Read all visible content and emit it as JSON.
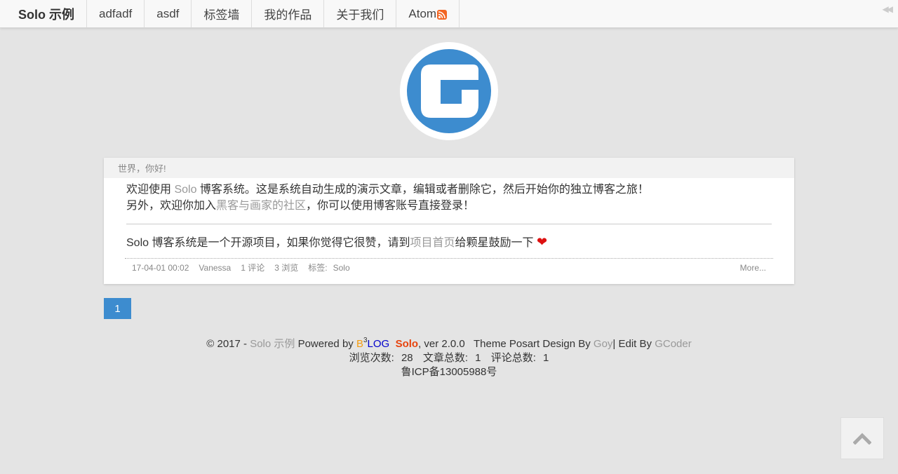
{
  "nav": {
    "brand": "Solo 示例",
    "items": [
      {
        "label": "adfadf"
      },
      {
        "label": "asdf"
      },
      {
        "label": "标签墙"
      },
      {
        "label": "我的作品"
      },
      {
        "label": "关于我们"
      },
      {
        "label": "Atom"
      }
    ]
  },
  "article": {
    "title": "世界，你好!",
    "line1_pre": "欢迎使用 ",
    "line1_link": "Solo",
    "line1_post": " 博客系统。这是系统自动生成的演示文章，编辑或者删除它，然后开始你的独立博客之旅！",
    "line2_pre": "另外，欢迎你加入",
    "line2_link": "黑客与画家的社区",
    "line2_post": "，你可以使用博客账号直接登录！",
    "line3_pre": "Solo 博客系统是一个开源项目，如果你觉得它很赞，请到",
    "line3_link": "项目首页",
    "line3_post": "给颗星鼓励一下 ",
    "heart": "❤",
    "meta": {
      "date": "17-04-01 00:02",
      "author": "Vanessa",
      "comments": "1 评论",
      "views": "3 浏览",
      "tags_label": "标签:",
      "tag": "Solo",
      "more": "More..."
    }
  },
  "pagination": {
    "current": "1"
  },
  "footer": {
    "copyright": "© 2017 - ",
    "site_name": "Solo 示例",
    "powered_by": " Powered by ",
    "b3log_b": "B",
    "b3log_3": "3",
    "b3log_log": "LOG",
    "solo": "Solo",
    "version": ", ver 2.0.0   Theme Posart Design By ",
    "designer": "Goy",
    "edit_by": "| Edit By ",
    "editor": "GCoder",
    "stats_views_label": "浏览次数:",
    "stats_views": "28",
    "stats_articles_label": "文章总数:",
    "stats_articles": "1",
    "stats_comments_label": "评论总数:",
    "stats_comments": "1",
    "icp": "鲁ICP备13005988号"
  },
  "colors": {
    "accent": "#3d8ccf",
    "solo_brand": "#e7440e",
    "background": "#e4e4e4"
  }
}
